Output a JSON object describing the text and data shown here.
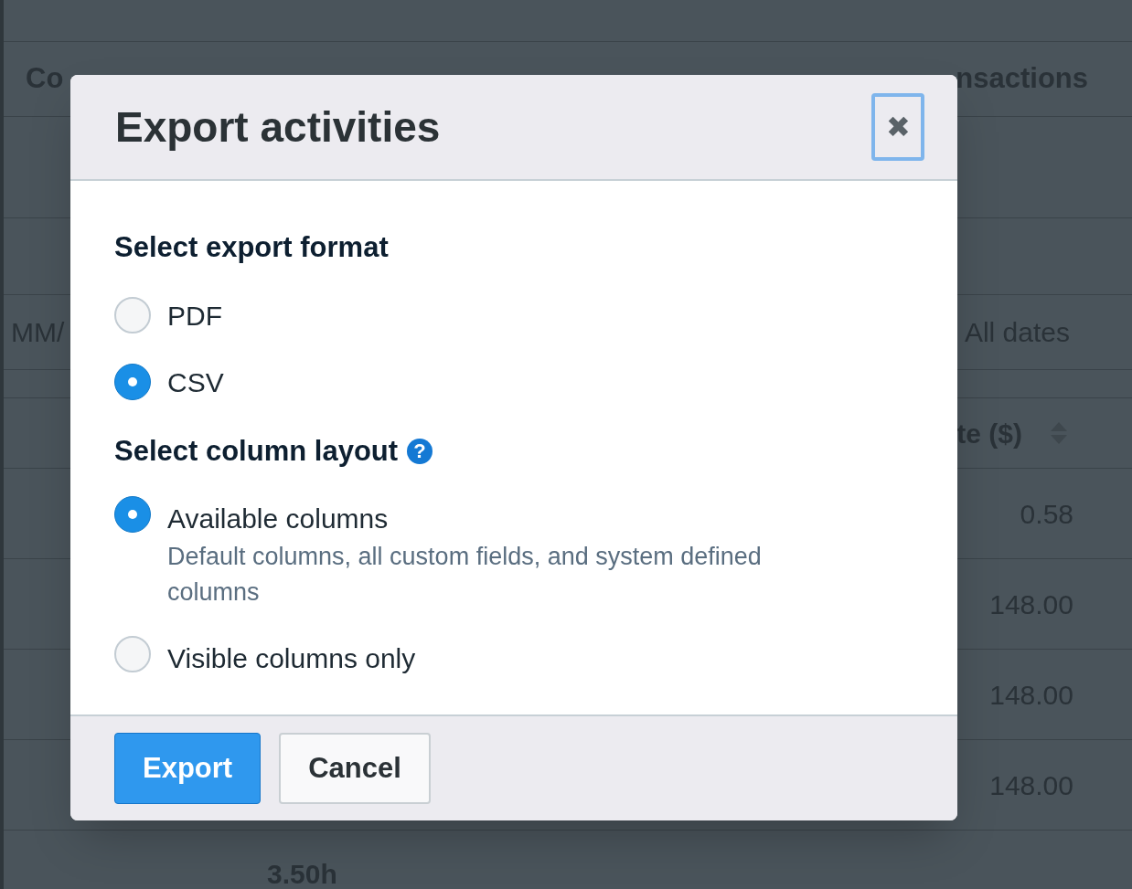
{
  "background": {
    "tabs": [
      "Co",
      "nsactions"
    ],
    "filter": {
      "date_field": "MM/",
      "range": "All dates"
    },
    "column_header": "te ($)",
    "cells": [
      "0.58",
      "148.00",
      "148.00",
      "148.00"
    ],
    "total": "3.50h"
  },
  "dialog": {
    "title": "Export activities",
    "close": "✖",
    "format_heading": "Select export format",
    "formats": [
      {
        "label": "PDF",
        "selected": false
      },
      {
        "label": "CSV",
        "selected": true
      }
    ],
    "layout_heading": "Select column layout",
    "help": "?",
    "layouts": [
      {
        "label": "Available columns",
        "description": "Default columns, all custom fields, and system defined columns",
        "selected": true
      },
      {
        "label": "Visible columns only",
        "selected": false
      }
    ],
    "buttons": [
      {
        "label": "Export",
        "kind": "primary"
      },
      {
        "label": "Cancel",
        "kind": "secondary"
      }
    ]
  }
}
